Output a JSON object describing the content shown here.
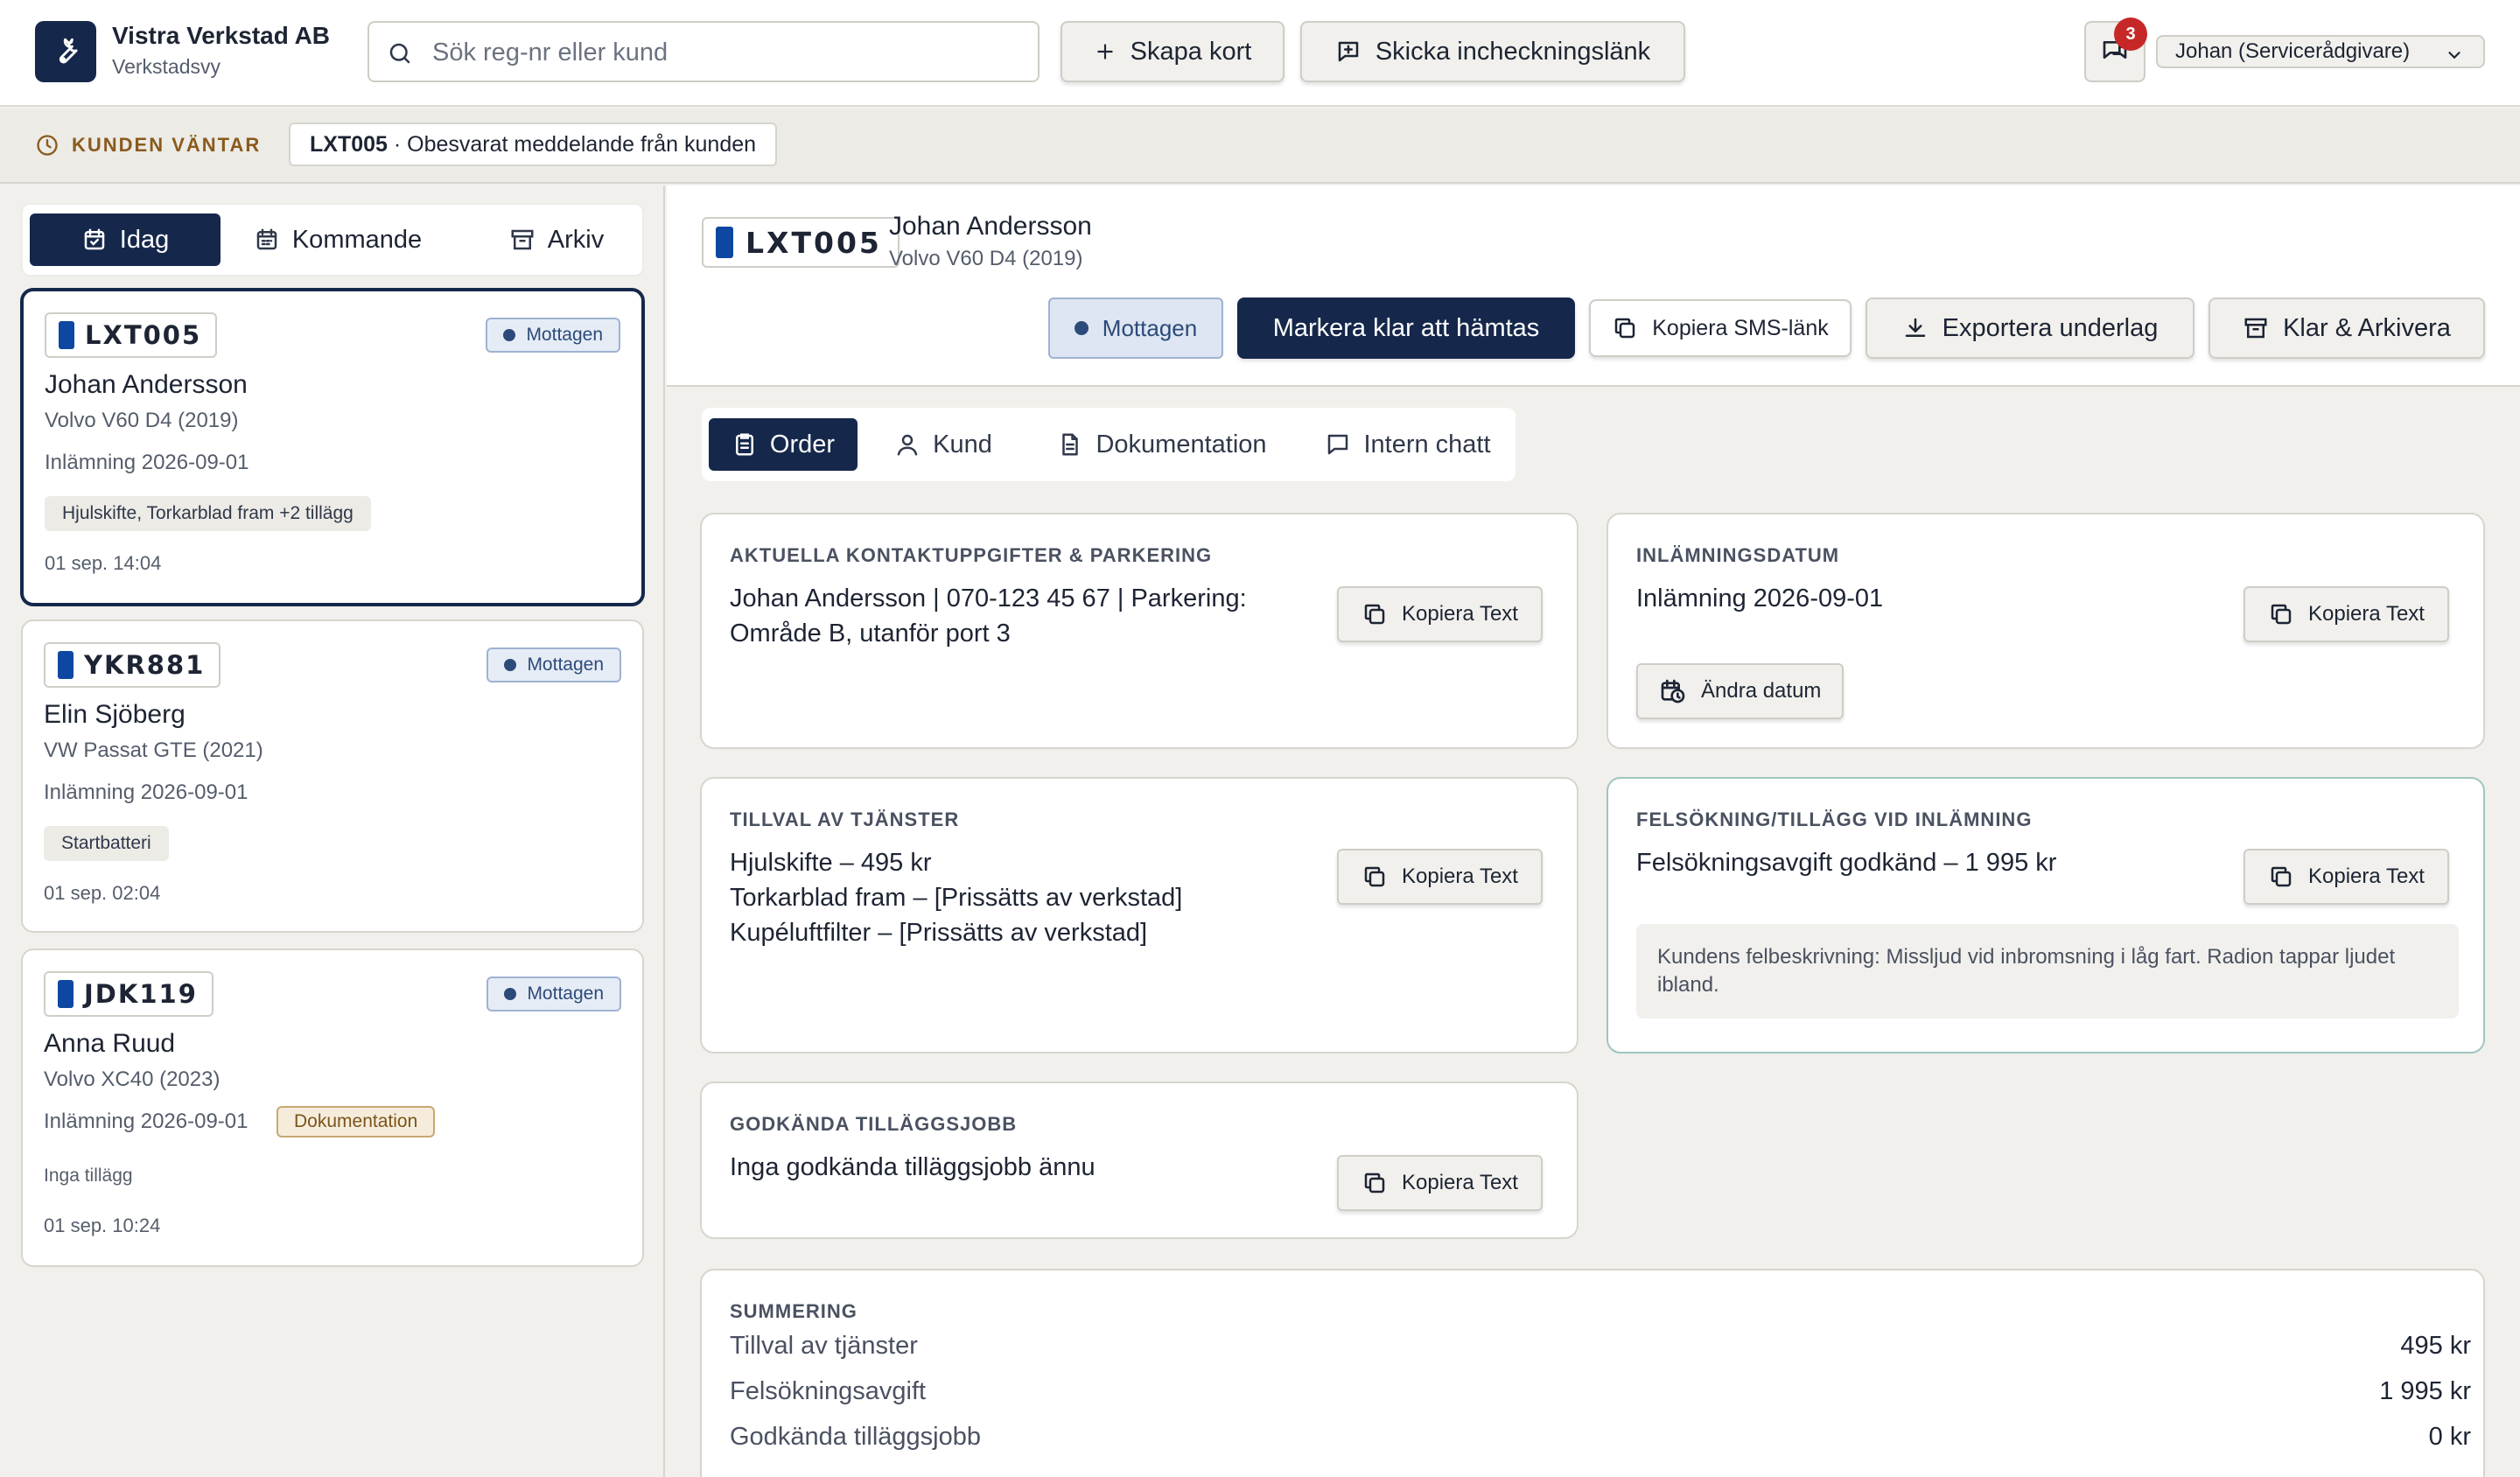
{
  "header": {
    "brand_name": "Vistra Verkstad AB",
    "brand_sub": "Verkstadsvy",
    "search_placeholder": "Sök reg-nr eller kund",
    "create_card": "Skapa kort",
    "send_checkin": "Skicka incheckningslänk",
    "notification_count": "3",
    "user": "Johan (Servicerådgivare)"
  },
  "waiting": {
    "label": "KUNDEN VÄNTAR",
    "plate": "LXT005",
    "message": " · Obesvarat meddelande från kunden"
  },
  "sidebar": {
    "tabs": [
      "Idag",
      "Kommande",
      "Arkiv"
    ],
    "active_tab": "Idag",
    "cards": [
      {
        "plate": "LXT005",
        "status": "Mottagen",
        "name": "Johan Andersson",
        "car": "Volvo V60 D4 (2019)",
        "date": "Inlämning 2026-09-01",
        "tag": "Hjulskifte, Torkarblad fram +2 tillägg",
        "time": "01 sep. 14:04",
        "selected": true
      },
      {
        "plate": "YKR881",
        "status": "Mottagen",
        "name": "Elin Sjöberg",
        "car": "VW Passat GTE (2021)",
        "date": "Inlämning 2026-09-01",
        "tag": "Startbatteri",
        "time": "01 sep. 02:04"
      },
      {
        "plate": "JDK119",
        "status": "Mottagen",
        "name": "Anna Ruud",
        "car": "Volvo XC40 (2023)",
        "date": "Inlämning 2026-09-01",
        "doc_tag": "Dokumentation",
        "extra": "Inga tillägg",
        "time": "01 sep. 10:24"
      }
    ]
  },
  "detail": {
    "plate": "LXT005",
    "name": "Johan Andersson",
    "car": "Volvo V60 D4 (2019)",
    "status": "Mottagen",
    "actions": {
      "mark_ready": "Markera klar att hämtas",
      "copy_sms": "Kopiera SMS-länk",
      "export": "Exportera underlag",
      "archive": "Klar & Arkivera"
    },
    "tabs": [
      "Order",
      "Kund",
      "Dokumentation",
      "Intern chatt"
    ],
    "active_tab": "Order",
    "copy_label": "Kopiera Text",
    "contact": {
      "title": "AKTUELLA KONTAKTUPPGIFTER & PARKERING",
      "line1": "Johan Andersson | 070-123 45 67 | Parkering:",
      "line2": "Område B, utanför port 3"
    },
    "dropoff": {
      "title": "INLÄMNINGSDATUM",
      "value": "Inlämning 2026-09-01",
      "change": "Ändra datum"
    },
    "services": {
      "title": "TILLVAL AV TJÄNSTER",
      "items": [
        "Hjulskifte – 495 kr",
        "Torkarblad fram – [Prissätts av verkstad]",
        "Kupéluftfilter – [Prissätts av verkstad]"
      ]
    },
    "diagnostics": {
      "title": "FELSÖKNING/TILLÄGG VID INLÄMNING",
      "value": "Felsökningsavgift godkänd – 1 995 kr",
      "note": "Kundens felbeskrivning: Missljud vid inbromsning i låg fart. Radion tappar ljudet ibland."
    },
    "approved": {
      "title": "GODKÄNDA TILLÄGGSJOBB",
      "value": "Inga godkända tilläggsjobb ännu"
    },
    "summary": {
      "title": "SUMMERING",
      "rows": [
        {
          "label": "Tillval av tjänster",
          "value": "495 kr"
        },
        {
          "label": "Felsökningsavgift",
          "value": "1 995 kr"
        },
        {
          "label": "Godkända tilläggsjobb",
          "value": "0 kr"
        }
      ]
    }
  },
  "colors": {
    "navy": "#15284b",
    "status_bg": "#e6ecf5",
    "status_text": "#2c4a7a",
    "waiting_label": "#8a5a1c",
    "badge": "#c62828",
    "eu_band": "#0d47a1"
  }
}
